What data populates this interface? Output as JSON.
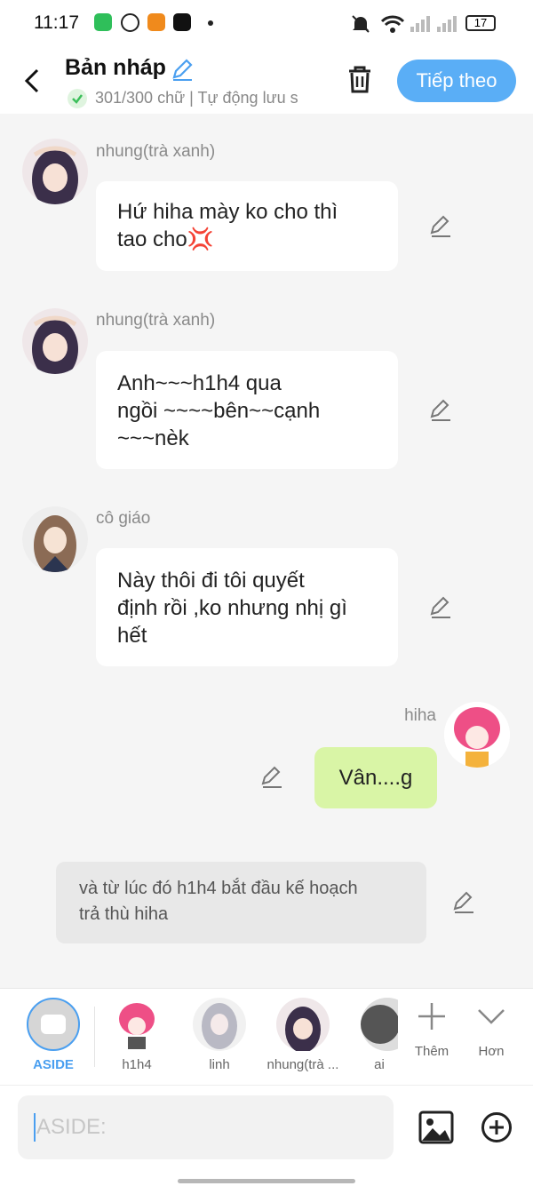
{
  "status_bar": {
    "time": "11:17",
    "battery": "17"
  },
  "header": {
    "title": "Bản nháp",
    "subtitle": "301/300 chữ | Tự động lưu s",
    "next_label": "Tiếp theo"
  },
  "messages": [
    {
      "sender": "nhung(trà xanh)",
      "line1": "Hứ hiha mày ko cho thì",
      "line2": "tao cho💢"
    },
    {
      "sender": "nhung(trà xanh)",
      "line1": "Anh~~~h1h4 qua",
      "line2": "ngồi ~~~~bên~~cạnh",
      "line3": "~~~nèk"
    },
    {
      "sender": "cô giáo",
      "line1": "Này thôi đi tôi quyết",
      "line2": "định rồi ,ko nhưng nhị gì",
      "line3": "hết"
    },
    {
      "sender": "hiha",
      "text": "Vân....g"
    },
    {
      "line1": "và từ lúc đó h1h4 bắt đầu kế hoạch",
      "line2": "trả thù hiha"
    }
  ],
  "characters": [
    {
      "label": "ASIDE"
    },
    {
      "label": "h1h4"
    },
    {
      "label": "linh"
    },
    {
      "label": "nhung(trà ..."
    },
    {
      "label": "ai"
    }
  ],
  "more_label": "Thêm",
  "less_label": "Hơn",
  "input": {
    "placeholder": "ASIDE:"
  },
  "colors": {
    "accent": "#5aaef6",
    "right_bubble": "#d9f5a6",
    "aside_label": "#4a9ff0"
  }
}
